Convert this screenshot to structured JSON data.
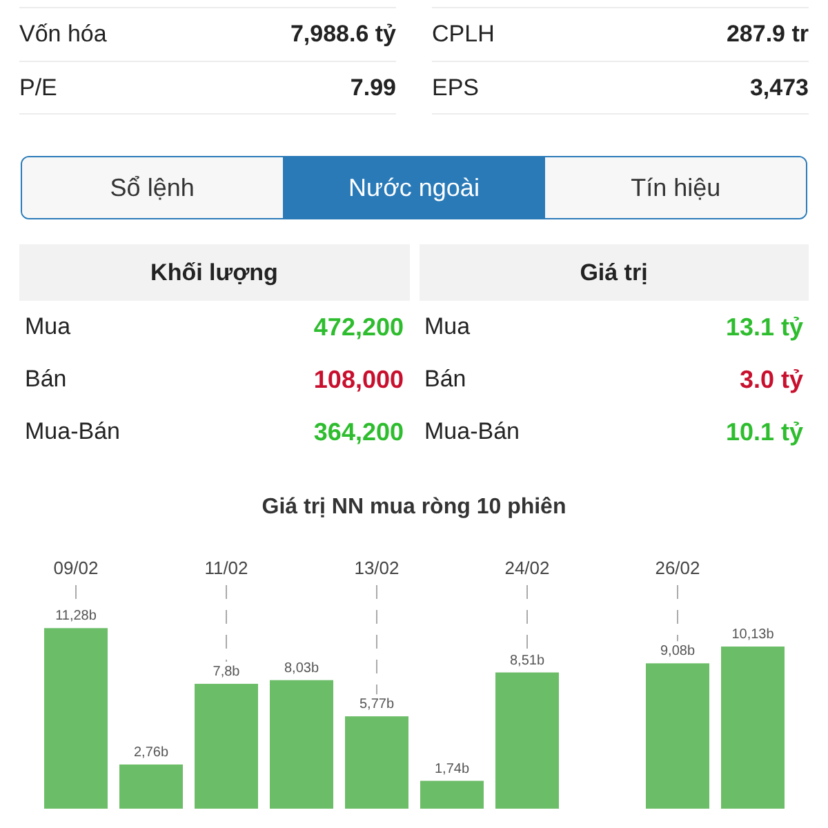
{
  "stats": [
    {
      "label": "Vốn hóa",
      "value": "7,988.6 tỷ"
    },
    {
      "label": "CPLH",
      "value": "287.9 tr"
    },
    {
      "label": "P/E",
      "value": "7.99"
    },
    {
      "label": "EPS",
      "value": "3,473"
    }
  ],
  "tabs": [
    {
      "label": "Sổ lệnh",
      "selected": false
    },
    {
      "label": "Nước ngoài",
      "selected": true
    },
    {
      "label": "Tín hiệu",
      "selected": false
    }
  ],
  "tables": [
    {
      "header": "Khối lượng",
      "rows": [
        {
          "label": "Mua",
          "value": "472,200",
          "kind": "up"
        },
        {
          "label": "Bán",
          "value": "108,000",
          "kind": "down"
        },
        {
          "label": "Mua-Bán",
          "value": "364,200",
          "kind": "up"
        }
      ]
    },
    {
      "header": "Giá trị",
      "rows": [
        {
          "label": "Mua",
          "value": "13.1 tỷ",
          "kind": "up"
        },
        {
          "label": "Bán",
          "value": "3.0 tỷ",
          "kind": "down"
        },
        {
          "label": "Mua-Bán",
          "value": "10.1 tỷ",
          "kind": "up"
        }
      ]
    }
  ],
  "chart": {
    "chart_data": {
      "type": "bar",
      "title": "Giá trị NN mua ròng 10 phiên",
      "categories": [
        "09/02",
        null,
        "11/02",
        null,
        "13/02",
        null,
        "24/02",
        null,
        "26/02",
        null
      ],
      "values": [
        11.28,
        2.76,
        7.8,
        8.03,
        5.77,
        1.74,
        8.51,
        null,
        9.08,
        10.13
      ],
      "value_labels": [
        "11,28b",
        "2,76b",
        "7,8b",
        "8,03b",
        "5,77b",
        "1,74b",
        "8,51b",
        null,
        "9,08b",
        "10,13b"
      ]
    }
  }
}
